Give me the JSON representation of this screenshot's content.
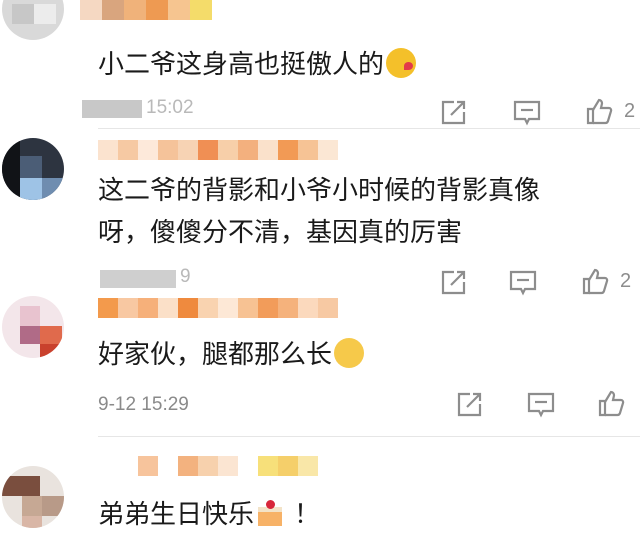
{
  "comments": [
    {
      "text": "小二爷这身高也挺傲人的",
      "emoji": "kissing-face-emoji",
      "time": "15:02",
      "like_count": "2"
    },
    {
      "text_line1": "这二爷的背影和小爷小时候的背影真像",
      "text_line2": "呀，傻傻分不清，基因真的厉害",
      "time": "9",
      "like_count": "2"
    },
    {
      "text": "好家伙，腿都那么长",
      "emoji": "thinking-face-emoji",
      "time": "9-12 15:29"
    },
    {
      "text": "弟弟生日快乐",
      "emoji": "birthday-cake-emoji",
      "suffix": "！"
    }
  ],
  "icons": {
    "share": "share-icon",
    "comment": "comment-icon",
    "like": "thumbs-up-icon"
  },
  "colors": {
    "text": "#1a1a1a",
    "meta": "#8a8a8a",
    "icon": "#8d8d8d",
    "name_blur_orange": "#f39a4c"
  }
}
